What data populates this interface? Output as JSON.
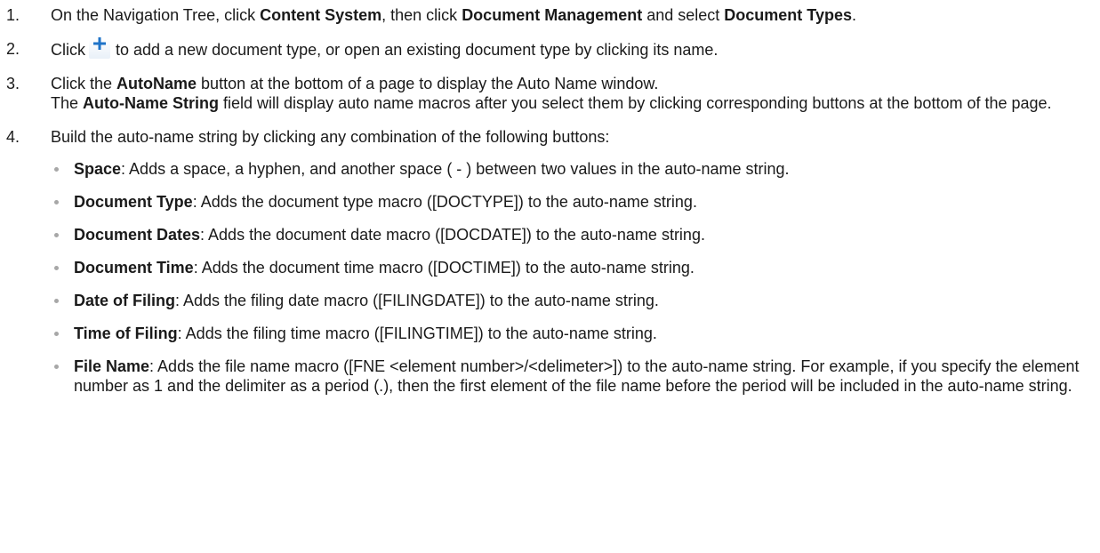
{
  "steps": [
    {
      "number": "1.",
      "t1": "On the Navigation Tree, click ",
      "b1": "Content System",
      "t2": ", then click ",
      "b2": "Document Management",
      "t3": " and select ",
      "b3": "Document Types",
      "t4": "."
    },
    {
      "number": "2.",
      "t1": "Click",
      "icon": "add-plus-icon",
      "t2": "to add a new document type, or open an existing document type by clicking its name."
    },
    {
      "number": "3.",
      "t1": "Click the ",
      "b1": "AutoName",
      "t2": " button at the bottom of a page to display the Auto Name window.",
      "t3": "The ",
      "b2": "Auto-Name String",
      "t4": " field will display auto name macros after you select them by clicking corresponding buttons at the bottom of the page."
    },
    {
      "number": "4.",
      "text": "Build the auto-name string by clicking any combination of the following buttons:"
    }
  ],
  "bullets": [
    {
      "term": "Space",
      "desc": ": Adds a space, a hyphen, and another space ( - ) between two values in the auto-name string."
    },
    {
      "term": "Document Type",
      "desc": ": Adds the document type macro ([DOCTYPE]) to the auto-name string."
    },
    {
      "term": "Document Dates",
      "desc": ": Adds the document date macro ([DOCDATE]) to the auto-name string."
    },
    {
      "term": "Document Time",
      "desc": ": Adds the document time macro ([DOCTIME]) to the auto-name string."
    },
    {
      "term": "Date of Filing",
      "desc": ": Adds the filing date macro ([FILINGDATE]) to the auto-name string."
    },
    {
      "term": "Time of Filing",
      "desc": ": Adds the filing time macro ([FILINGTIME]) to the auto-name string."
    },
    {
      "term": "File Name",
      "desc": ": Adds the file name macro ([FNE <element number>/<delimeter>]) to the auto-name string. For example, if you specify the element number as 1 and the delimiter as a period (.), then the first element of the file name before the period will be included in the auto-name string."
    }
  ],
  "colors": {
    "text": "#1a1a1a",
    "bullet": "#a7a7a7",
    "icon_plus": "#1e73c8"
  }
}
